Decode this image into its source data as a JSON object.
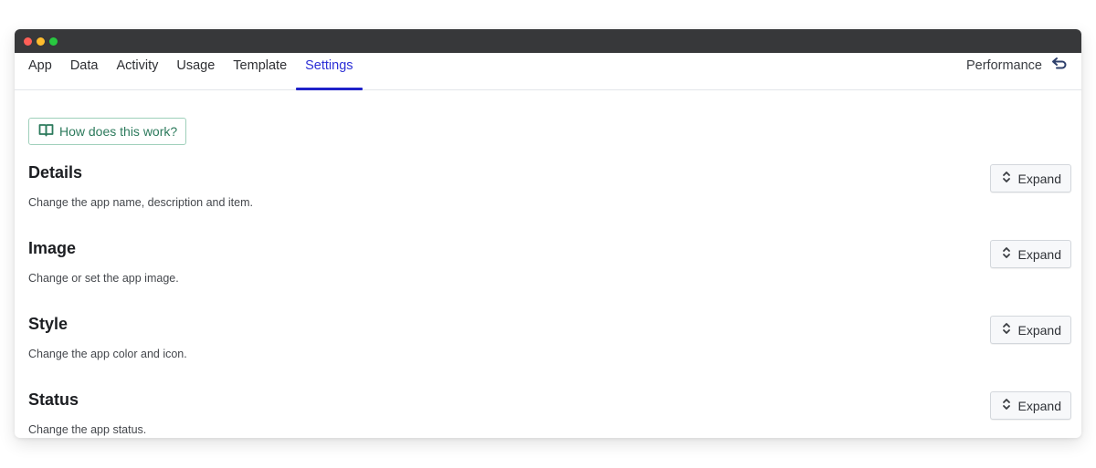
{
  "window": {
    "traffic_lights": [
      {
        "name": "close",
        "color": "#fe5f57"
      },
      {
        "name": "minimize",
        "color": "#febc2e"
      },
      {
        "name": "maximize",
        "color": "#28c840"
      }
    ]
  },
  "nav": {
    "tabs": [
      {
        "label": "App",
        "active": false
      },
      {
        "label": "Data",
        "active": false
      },
      {
        "label": "Activity",
        "active": false
      },
      {
        "label": "Usage",
        "active": false
      },
      {
        "label": "Template",
        "active": false
      },
      {
        "label": "Settings",
        "active": true
      }
    ],
    "performance_label": "Performance",
    "performance_icon": "undo-arrow-icon"
  },
  "help": {
    "label": "How does this work?",
    "icon": "book-open-icon"
  },
  "sections": [
    {
      "title": "Details",
      "description": "Change the app name, description and item.",
      "button": "Expand"
    },
    {
      "title": "Image",
      "description": "Change or set the app image.",
      "button": "Expand"
    },
    {
      "title": "Style",
      "description": "Change the app color and icon.",
      "button": "Expand"
    },
    {
      "title": "Status",
      "description": "Change the app status.",
      "button": "Expand"
    }
  ],
  "colors": {
    "accent": "#1f22c9",
    "help_green": "#2c7a5c",
    "titlebar": "#37383a"
  }
}
